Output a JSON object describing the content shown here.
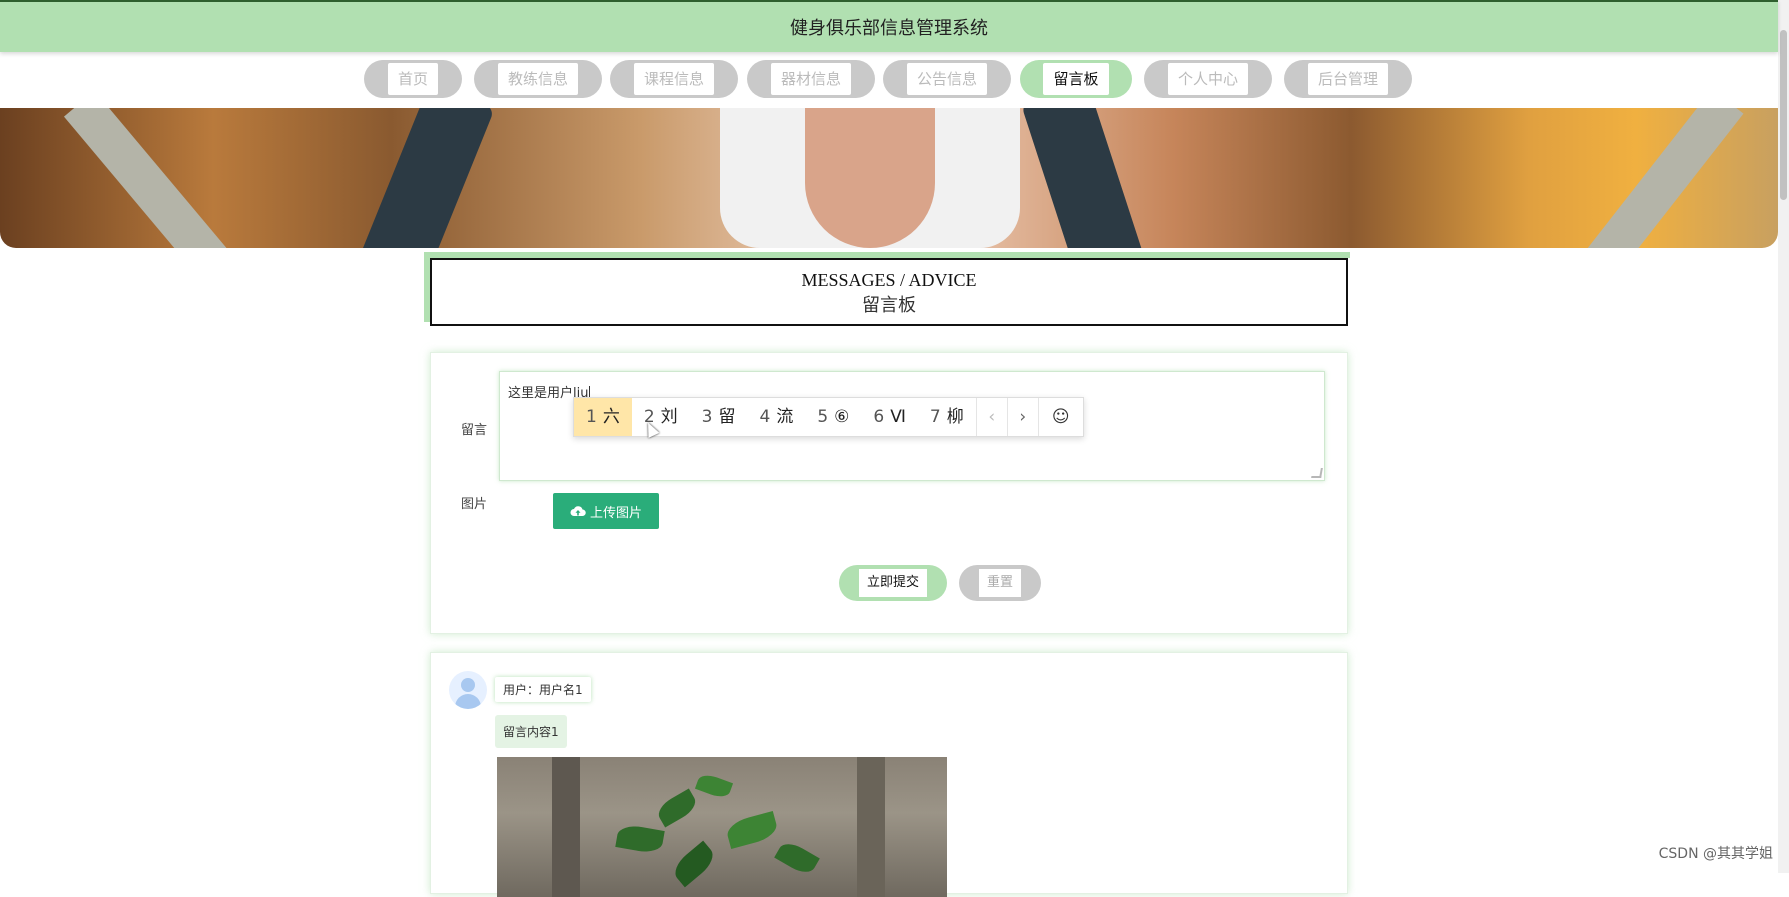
{
  "app": {
    "title": "健身俱乐部信息管理系统"
  },
  "nav": {
    "items": [
      {
        "label": "首页"
      },
      {
        "label": "教练信息"
      },
      {
        "label": "课程信息"
      },
      {
        "label": "器材信息"
      },
      {
        "label": "公告信息"
      },
      {
        "label": "留言板",
        "active": true
      },
      {
        "label": "个人中心"
      },
      {
        "label": "后台管理"
      }
    ]
  },
  "page": {
    "title_en": "MESSAGES / ADVICE",
    "title_cn": "留言板"
  },
  "form": {
    "message_label": "留言",
    "message_value": "这里是用户liu",
    "image_label": "图片",
    "upload_label": "上传图片",
    "submit_label": "立即提交",
    "reset_label": "重置"
  },
  "ime": {
    "candidates": [
      {
        "num": "1",
        "text": "六"
      },
      {
        "num": "2",
        "text": "刘"
      },
      {
        "num": "3",
        "text": "留"
      },
      {
        "num": "4",
        "text": "流"
      },
      {
        "num": "5",
        "text": "⑥"
      },
      {
        "num": "6",
        "text": "Ⅵ"
      },
      {
        "num": "7",
        "text": "柳"
      }
    ],
    "prev": "‹",
    "next": "›",
    "emoji": "☺"
  },
  "messages": [
    {
      "user": "用户：用户名1",
      "content": "留言内容1"
    }
  ],
  "watermark": "CSDN @其其学姐",
  "colors": {
    "accent": "#b1e0b1",
    "upload": "#2aad7a",
    "ime_selected": "#ffe6a8"
  }
}
